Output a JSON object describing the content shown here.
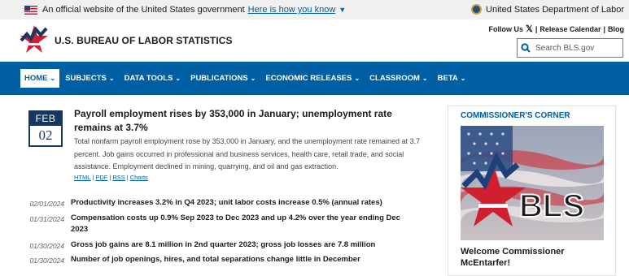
{
  "gov_banner": {
    "text": "An official website of the United States government",
    "link": "Here is how you know",
    "agency": "United States Department of Labor"
  },
  "header": {
    "brand": "U.S. BUREAU OF LABOR STATISTICS",
    "follow": "Follow Us",
    "release_calendar": "Release Calendar",
    "blog": "Blog",
    "search_placeholder": "Search BLS.gov"
  },
  "nav": [
    {
      "label": "HOME"
    },
    {
      "label": "SUBJECTS"
    },
    {
      "label": "DATA TOOLS"
    },
    {
      "label": "PUBLICATIONS"
    },
    {
      "label": "ECONOMIC RELEASES"
    },
    {
      "label": "CLASSROOM"
    },
    {
      "label": "BETA"
    }
  ],
  "feature": {
    "month": "FEB",
    "day": "02",
    "title": "Payroll employment rises by 353,000 in January; unemployment rate remains at 3.7%",
    "body": "Total nonfarm payroll employment rose by 353,000 in January, and the unemployment rate remained at 3.7 percent. Job gains occurred in professional and business services, health care, retail trade, and social assistance. Employment declined in mining, quarrying, and oil and gas extraction.",
    "links": [
      "HTML",
      "PDF",
      "RSS",
      "Charts"
    ]
  },
  "news": [
    {
      "date": "02/01/2024",
      "title": "Productivity increases 3.2% in Q4 2023; unit labor costs increase 0.5% (annual rates)"
    },
    {
      "date": "01/31/2024",
      "title": "Compensation costs up 0.9% Sep 2023 to Dec 2023 and up 4.2% over the year ending Dec 2023"
    },
    {
      "date": "01/30/2024",
      "title": "Gross job gains are 8.1 million in 2nd quarter 2023; gross job losses are 7.8 million"
    },
    {
      "date": "01/30/2024",
      "title": "Number of job openings, hires, and total separations change little in December"
    }
  ],
  "sidebar": {
    "heading": "COMMISSIONER'S CORNER",
    "image_text": "BLS",
    "caption": "Welcome Commissioner McEntarfer!"
  },
  "colors": {
    "nav_blue": "#005ea2",
    "calendar_navy": "#17375e",
    "logo_red": "#d02030"
  }
}
